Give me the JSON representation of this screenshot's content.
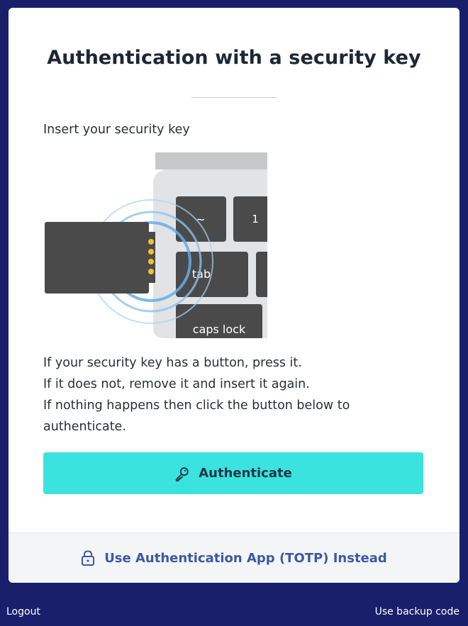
{
  "card": {
    "title": "Authentication with a security key",
    "instruction": "Insert your security key",
    "help_lines": [
      "If your security key has a button, press it.",
      "If it does not, remove it and insert it again.",
      "If nothing happens then click the button below to",
      "authenticate."
    ],
    "authenticate_button": {
      "label": "Authenticate",
      "icon": "key-icon",
      "color": "#3be3df"
    },
    "footer": {
      "label": "Use Authentication App (TOTP) Instead",
      "icon": "lock-icon"
    }
  },
  "illustration": {
    "keys": {
      "tilde": "~",
      "one": "1",
      "tab": "tab",
      "caps": "caps lock"
    }
  },
  "bottom_links": {
    "logout": "Logout",
    "backup": "Use backup code"
  },
  "colors": {
    "background": "#1a1f6b",
    "accent": "#3be3df",
    "footer_link": "#3d58a6"
  }
}
